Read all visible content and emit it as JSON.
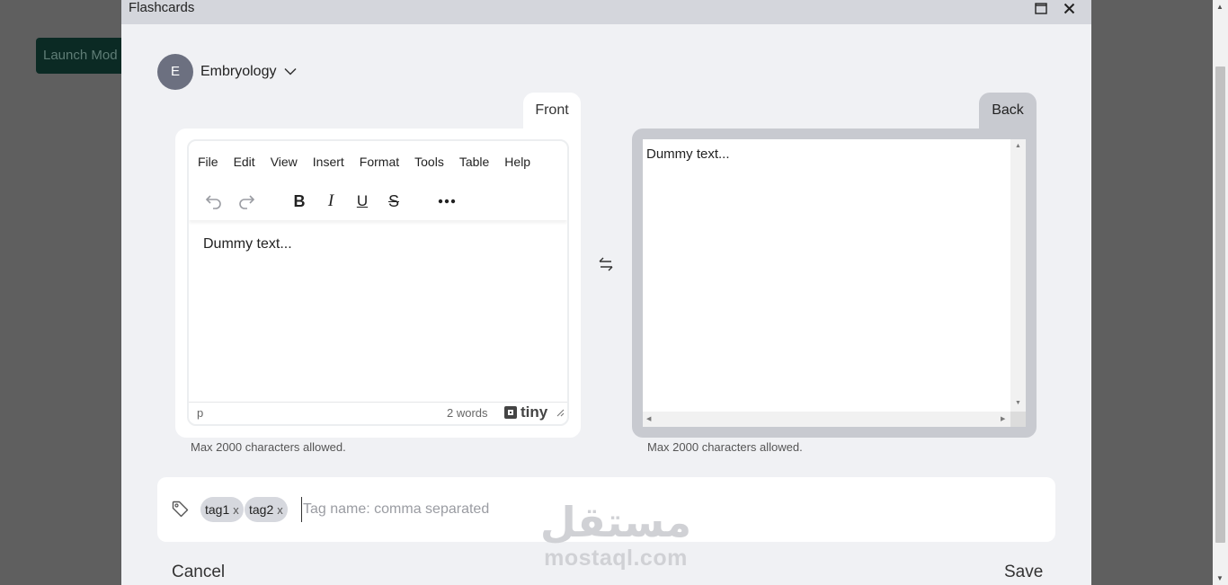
{
  "background": {
    "launch_button_label": "Launch Mod"
  },
  "modal": {
    "title": "Flashcards",
    "maximize_icon": "maximize-icon",
    "close_icon": "close-icon"
  },
  "deck": {
    "avatar_letter": "E",
    "name": "Embryology",
    "dropdown_icon": "chevron-down-icon"
  },
  "front": {
    "tab_label": "Front",
    "menu": [
      "File",
      "Edit",
      "View",
      "Insert",
      "Format",
      "Tools",
      "Table",
      "Help"
    ],
    "toolbar_icons": [
      "undo-icon",
      "redo-icon",
      "bold-icon",
      "italic-icon",
      "underline-icon",
      "strikethrough-icon",
      "more-icon"
    ],
    "content": "Dummy text...",
    "status_path": "p",
    "word_count": "2 words",
    "brand": "tiny",
    "helper": "Max 2000 characters allowed."
  },
  "swap_icon": "swap-icon",
  "back": {
    "tab_label": "Back",
    "content": "Dummy text...",
    "helper": "Max 2000 characters allowed."
  },
  "tags": {
    "icon": "tag-icon",
    "items": [
      {
        "label": "tag1",
        "remove": "x"
      },
      {
        "label": "tag2",
        "remove": "x"
      }
    ],
    "input_value": "",
    "placeholder": "Tag name: comma separated"
  },
  "watermark": {
    "arabic": "مستقل",
    "latin": "mostaql.com"
  },
  "footer": {
    "cancel_label": "Cancel",
    "save_label": "Save"
  },
  "colors": {
    "overlay": "#5f5f5f",
    "modal_bg": "#f0f1f4",
    "header_bg": "#d4d6dc",
    "back_card": "#c8cad0",
    "avatar": "#6c7080",
    "tag_bg": "#d6d8de"
  }
}
